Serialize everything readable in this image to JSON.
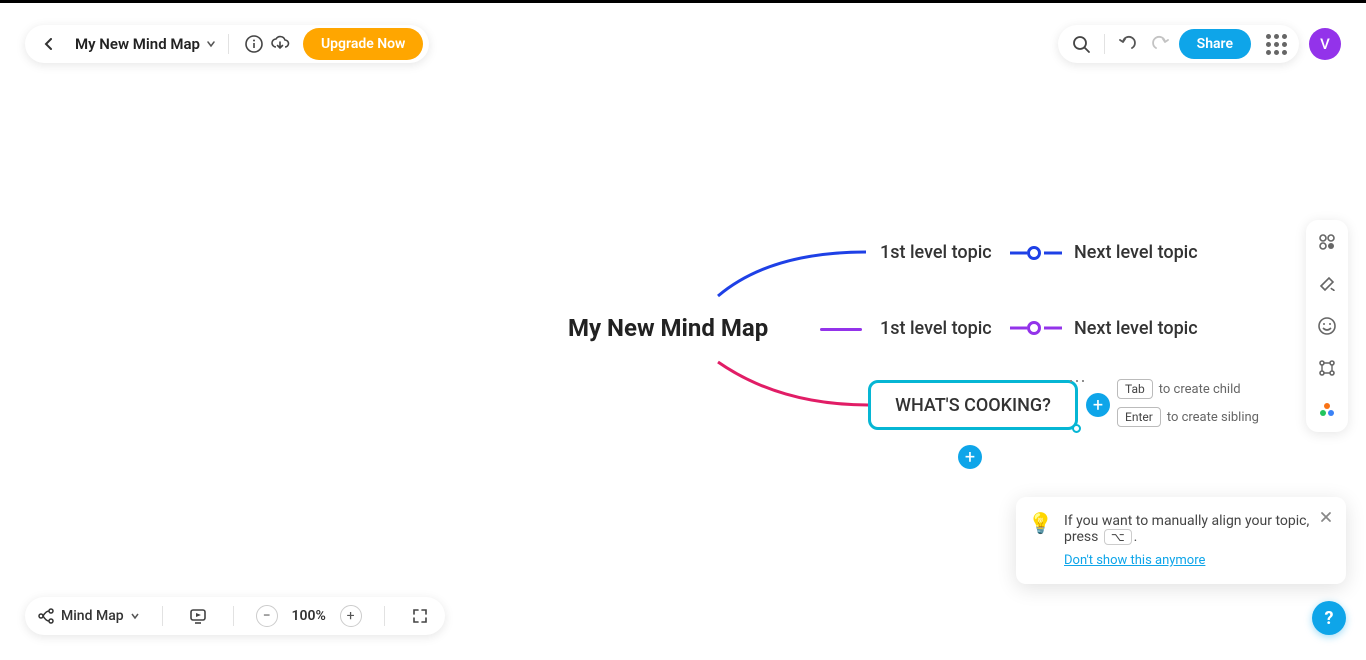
{
  "header": {
    "title": "My New Mind Map",
    "upgrade_label": "Upgrade Now",
    "share_label": "Share",
    "avatar_initial": "V"
  },
  "mindmap": {
    "root": "My New Mind Map",
    "level1_a": "1st level topic",
    "level1_b": "1st level topic",
    "level2_a": "Next level topic",
    "level2_b": "Next level topic",
    "selected": "WHAT'S COOKING?"
  },
  "hints": {
    "tab_key": "Tab",
    "tab_text": "to create child",
    "enter_key": "Enter",
    "enter_text": "to create sibling"
  },
  "tip": {
    "text_before": "If you want to manually align your topic, press",
    "key": "⌥",
    "text_after": ".",
    "link": "Don't show this anymore"
  },
  "bottom": {
    "view_label": "Mind Map",
    "zoom": "100%"
  }
}
